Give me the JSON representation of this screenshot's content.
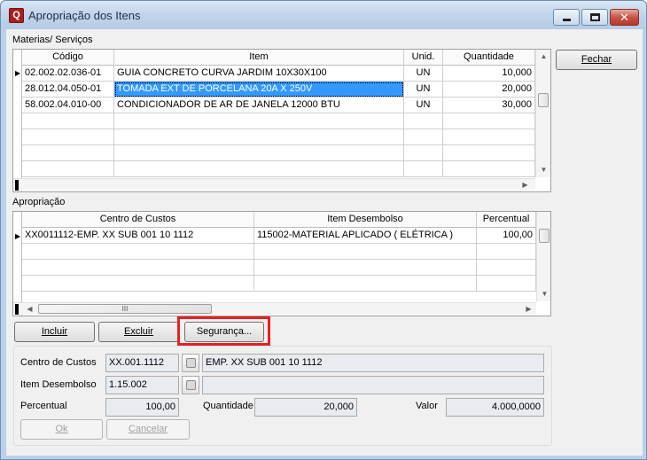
{
  "window": {
    "title": "Apropriação dos Itens"
  },
  "materials": {
    "section_label": "Materias/ Serviços",
    "columns": [
      "Código",
      "Item",
      "Unid.",
      "Quantidade"
    ],
    "rows": [
      {
        "code": "02.002.02.036-01",
        "item": "GUIA CONCRETO CURVA JARDIM 10X30X100",
        "unit": "UN",
        "qty": "10,000"
      },
      {
        "code": "28.012.04.050-01",
        "item": "TOMADA EXT DE PORCELANA 20A X 250V",
        "unit": "UN",
        "qty": "20,000"
      },
      {
        "code": "58.002.04.010-00",
        "item": "CONDICIONADOR DE AR DE JANELA 12000 BTU",
        "unit": "UN",
        "qty": "30,000"
      }
    ]
  },
  "apropriacao": {
    "section_label": "Apropriação",
    "columns": [
      "Centro de Custos",
      "Item Desembolso",
      "Percentual"
    ],
    "rows": [
      {
        "centro": "XX0011112-EMP. XX SUB 001 10 1112",
        "desembolso": "115002-MATERIAL APLICADO ( ELÉTRICA )",
        "percentual": "100,00"
      }
    ],
    "hscroll_grip": "III"
  },
  "buttons": {
    "fechar": "Fechar",
    "incluir": "Incluir",
    "excluir": "Excluir",
    "seguranca": "Segurança...",
    "ok": "Ok",
    "cancelar": "Cancelar"
  },
  "form": {
    "centro_label": "Centro de Custos",
    "centro_code": "XX.001.1112",
    "centro_desc": "EMP. XX SUB 001 10 1112",
    "desembolso_label": "Item Desembolso",
    "desembolso_code": "1.15.002",
    "desembolso_desc": "",
    "percentual_label": "Percentual",
    "percentual_value": "100,00",
    "quantidade_label": "Quantidade",
    "quantidade_value": "20,000",
    "valor_label": "Valor",
    "valor_value": "4.000,0000"
  }
}
